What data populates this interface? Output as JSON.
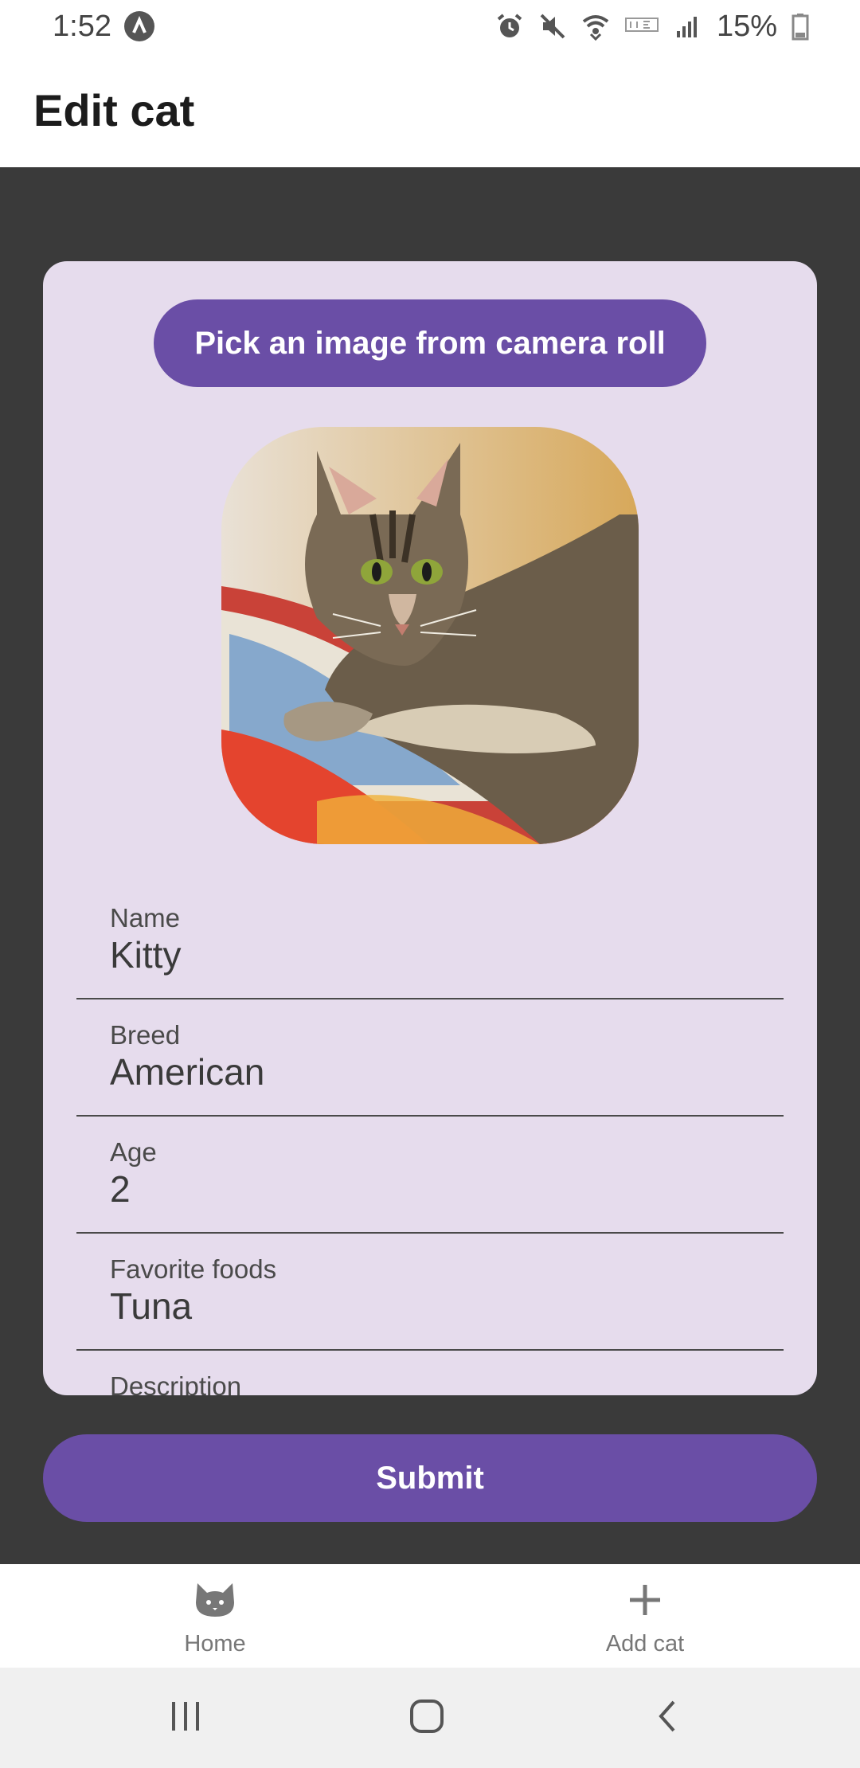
{
  "status_bar": {
    "time": "1:52",
    "battery": "15%",
    "icons": [
      "app-indicator-icon",
      "alarm-icon",
      "mute-icon",
      "wifi-icon",
      "volte-icon",
      "signal-icon",
      "battery-icon"
    ]
  },
  "header": {
    "title": "Edit cat"
  },
  "form": {
    "pick_image_label": "Pick an image from camera roll",
    "photo_icon": "cat-photo",
    "fields": [
      {
        "label": "Name",
        "value": "Kitty"
      },
      {
        "label": "Breed",
        "value": "American"
      },
      {
        "label": "Age",
        "value": "2"
      },
      {
        "label": "Favorite foods",
        "value": "Tuna"
      },
      {
        "label": "Description",
        "value": ""
      }
    ],
    "submit_label": "Submit"
  },
  "tab_bar": {
    "tabs": [
      {
        "label": "Home",
        "icon": "cat-icon"
      },
      {
        "label": "Add cat",
        "icon": "plus-icon"
      }
    ]
  },
  "nav_bar": {
    "icons": [
      "recents-icon",
      "home-icon",
      "back-icon"
    ]
  },
  "colors": {
    "accent": "#6a4ea6",
    "card_bg": "#e6dced",
    "content_bg": "#3a3a3a"
  }
}
